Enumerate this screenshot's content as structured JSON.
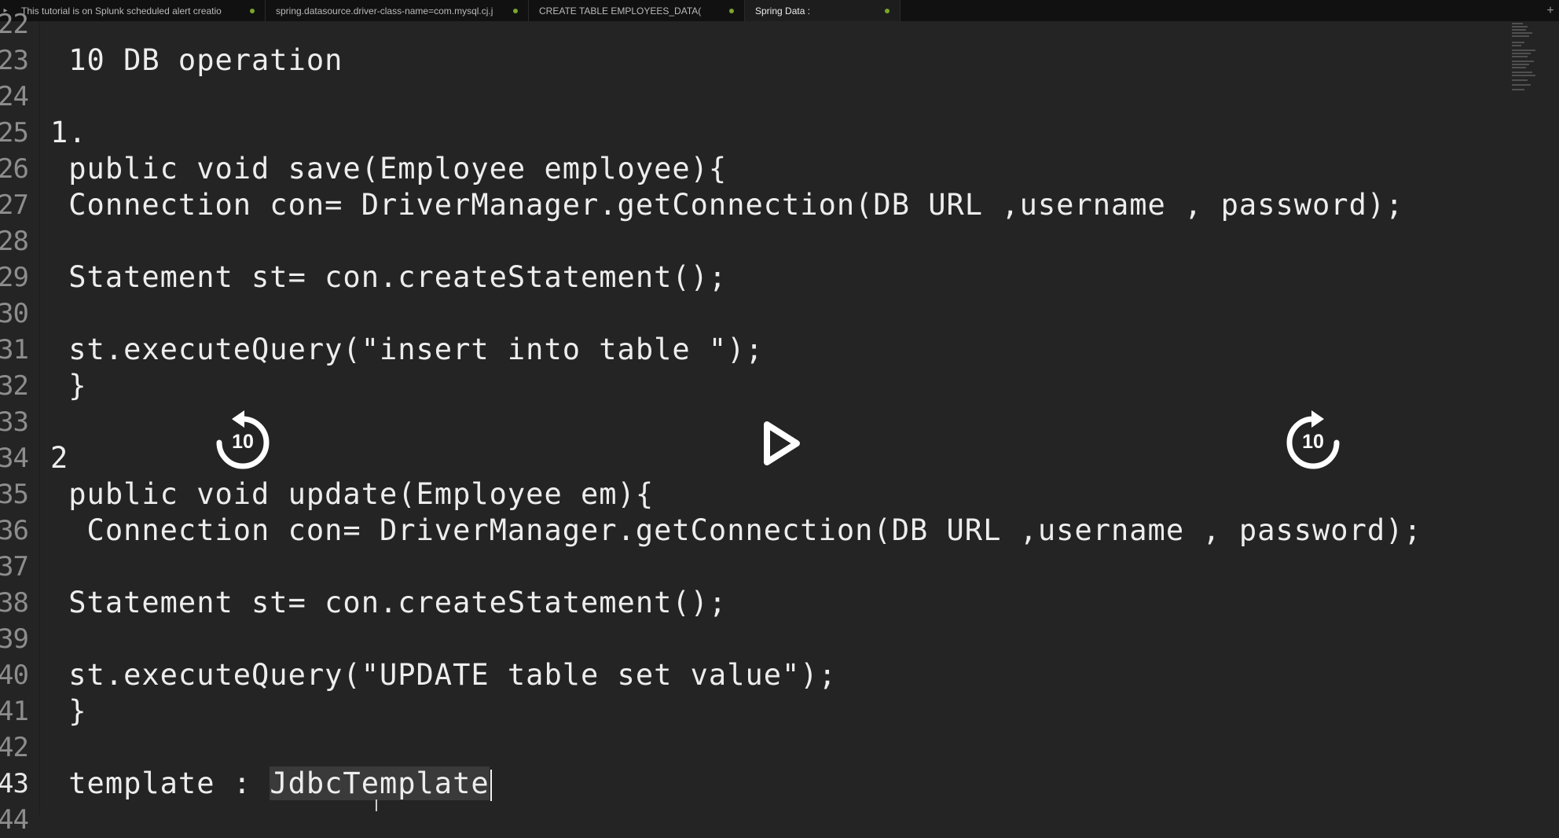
{
  "tabs": [
    {
      "label": "This tutorial is on Splunk scheduled alert creatio",
      "modified": true,
      "active": false
    },
    {
      "label": "spring.datasource.driver-class-name=com.mysql.cj.j",
      "modified": true,
      "active": false
    },
    {
      "label": "CREATE TABLE EMPLOYEES_DATA(",
      "modified": true,
      "active": false
    },
    {
      "label": "Spring Data :",
      "modified": true,
      "active": true
    }
  ],
  "tab_bar": {
    "scroll_left_icon": "▸",
    "new_tab_icon": "+"
  },
  "editor": {
    "lines": [
      {
        "num": "22",
        "text": ""
      },
      {
        "num": "23",
        "text": " 10 DB operation"
      },
      {
        "num": "24",
        "text": ""
      },
      {
        "num": "25",
        "text": "1."
      },
      {
        "num": "26",
        "text": " public void save(Employee employee){"
      },
      {
        "num": "27",
        "text": " Connection con= DriverManager.getConnection(DB URL ,username , password);"
      },
      {
        "num": "28",
        "text": ""
      },
      {
        "num": "29",
        "text": " Statement st= con.createStatement();"
      },
      {
        "num": "30",
        "text": ""
      },
      {
        "num": "31",
        "text": " st.executeQuery(\"insert into table \");"
      },
      {
        "num": "32",
        "text": " }"
      },
      {
        "num": "33",
        "text": ""
      },
      {
        "num": "34",
        "text": "2"
      },
      {
        "num": "35",
        "text": " public void update(Employee em){"
      },
      {
        "num": "36",
        "text": "  Connection con= DriverManager.getConnection(DB URL ,username , password);"
      },
      {
        "num": "37",
        "text": ""
      },
      {
        "num": "38",
        "text": " Statement st= con.createStatement();"
      },
      {
        "num": "39",
        "text": ""
      },
      {
        "num": "40",
        "text": " st.executeQuery(\"UPDATE table set value\");"
      },
      {
        "num": "41",
        "text": " }"
      },
      {
        "num": "42",
        "text": ""
      },
      {
        "num": "43",
        "text_prefix": " template : ",
        "text_selected": "JdbcTemplate",
        "current": true
      },
      {
        "num": "44",
        "text": ""
      }
    ]
  },
  "player": {
    "rewind_seconds": "10",
    "forward_seconds": "10",
    "play_icon": "play-icon",
    "rewind_icon": "rewind-10-icon",
    "forward_icon": "forward-10-icon"
  },
  "cursor_icon": "I-beam"
}
